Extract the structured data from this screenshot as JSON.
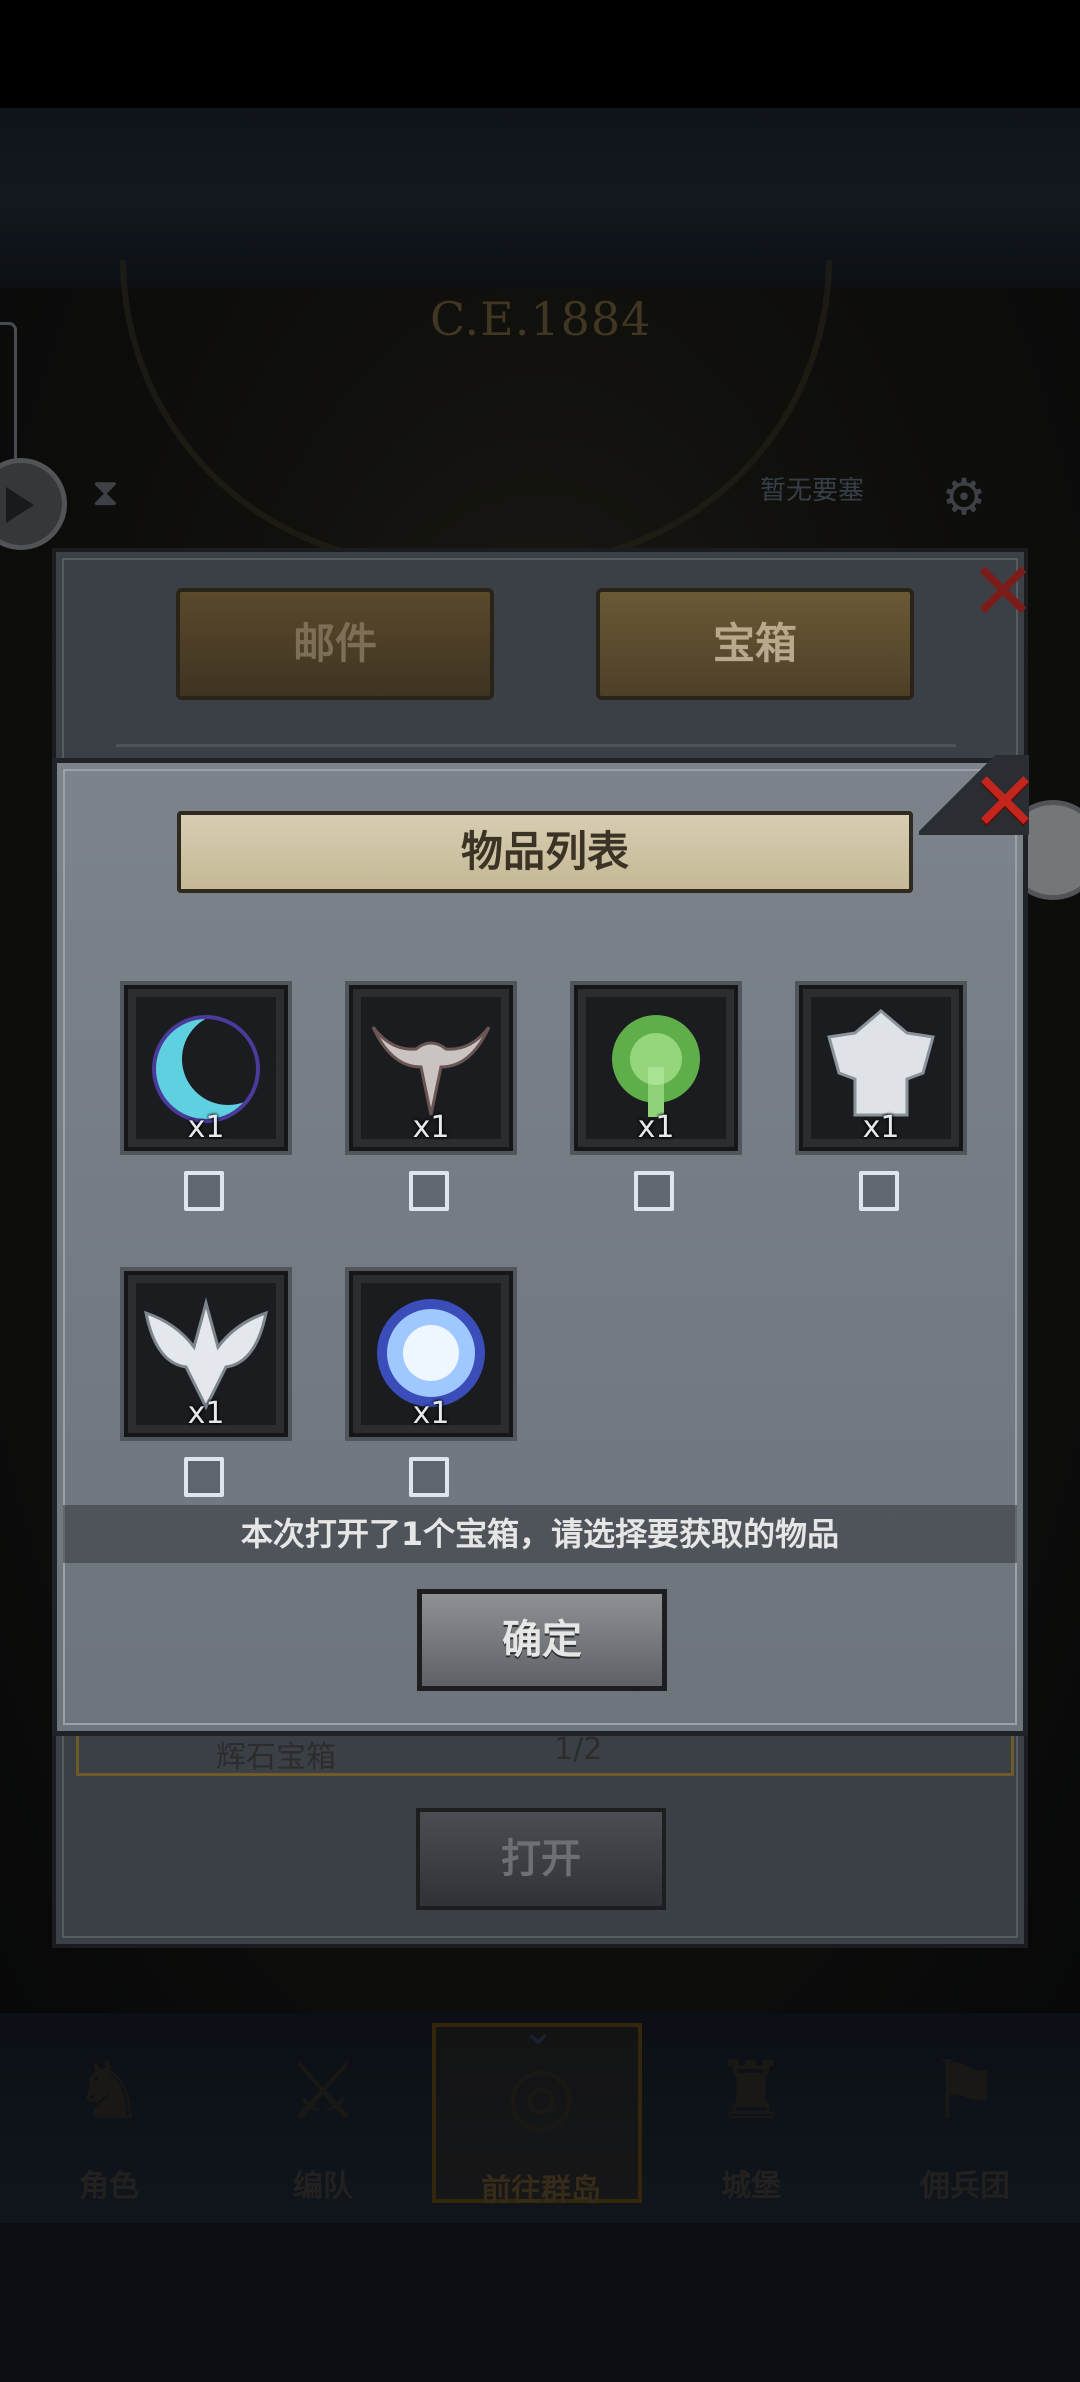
{
  "background": {
    "year_label": "C.E.1884",
    "notice_text": "暂无要塞"
  },
  "mail_panel": {
    "tabs": [
      {
        "label": "邮件"
      },
      {
        "label": "宝箱"
      }
    ],
    "row_text": "辉石宝箱",
    "row_count": "1/2",
    "open_button": "打开"
  },
  "item_dialog": {
    "title": "物品列表",
    "items": [
      {
        "icon": "crescent-blade-icon",
        "qty": "x1",
        "checked": false
      },
      {
        "icon": "horned-helm-icon",
        "qty": "x1",
        "checked": false
      },
      {
        "icon": "spirit-tree-icon",
        "qty": "x1",
        "checked": false
      },
      {
        "icon": "silver-scales-icon",
        "qty": "x1",
        "checked": false
      },
      {
        "icon": "winged-crest-icon",
        "qty": "x1",
        "checked": false
      },
      {
        "icon": "blue-orb-icon",
        "qty": "x1",
        "checked": false
      }
    ],
    "hint": "本次打开了1个宝箱，请选择要获取的物品",
    "confirm_button": "确定"
  },
  "bottom_nav": [
    {
      "label": "角色",
      "icon": "knight-icon"
    },
    {
      "label": "编队",
      "icon": "formation-icon"
    },
    {
      "label": "前往群岛",
      "icon": "globe-icon",
      "active": true
    },
    {
      "label": "城堡",
      "icon": "castle-icon"
    },
    {
      "label": "佣兵团",
      "icon": "mercenary-icon"
    }
  ],
  "colors": {
    "accent_gold": "#5a4214",
    "close_red": "#c4261e",
    "panel_gray": "#737a82"
  }
}
